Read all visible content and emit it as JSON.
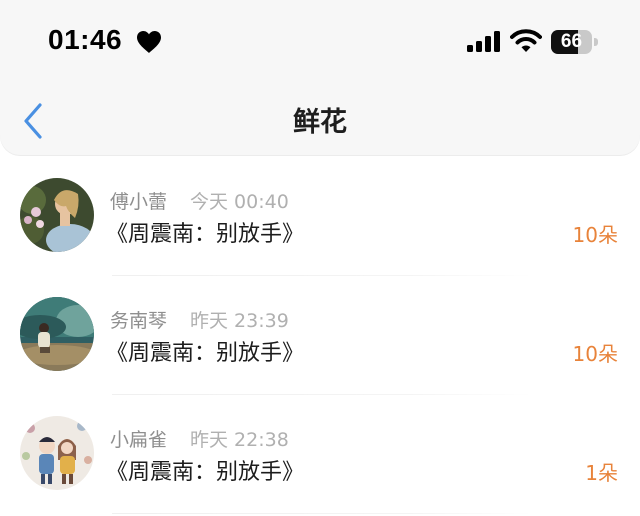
{
  "status_bar": {
    "time": "01:46",
    "heart_icon": "heart-icon",
    "signal_icon": "cellular-signal-icon",
    "wifi_icon": "wifi-icon",
    "battery_level": "66"
  },
  "nav": {
    "back_icon": "chevron-left-icon",
    "title": "鲜花"
  },
  "items": [
    {
      "user": "傅小蕾",
      "time": "今天 00:40",
      "song": "《周震南：别放手》",
      "count": "10朵",
      "avatar": "avatar-woman-flowers"
    },
    {
      "user": "务南琴",
      "time": "昨天 23:39",
      "song": "《周震南：别放手》",
      "count": "10朵",
      "avatar": "avatar-person-lake"
    },
    {
      "user": "小扁雀",
      "time": "昨天 22:38",
      "song": "《周震南：别放手》",
      "count": "1朵",
      "avatar": "avatar-illustrated-couple"
    }
  ],
  "colors": {
    "accent_back": "#4a90e2",
    "flower_count": "#e8833a"
  }
}
